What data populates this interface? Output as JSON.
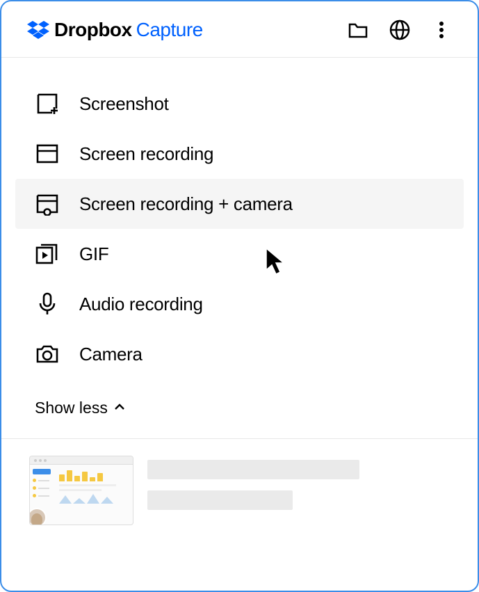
{
  "header": {
    "brand_main": "Dropbox",
    "brand_sub": "Capture"
  },
  "menu": {
    "items": [
      {
        "label": "Screenshot"
      },
      {
        "label": "Screen recording"
      },
      {
        "label": "Screen recording + camera"
      },
      {
        "label": "GIF"
      },
      {
        "label": "Audio recording"
      },
      {
        "label": "Camera"
      }
    ],
    "toggle_label": "Show less"
  }
}
